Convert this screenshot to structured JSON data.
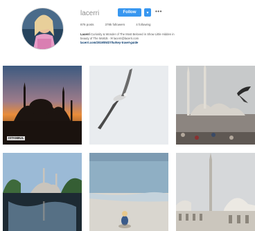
{
  "profile": {
    "username": "lacerri",
    "follow_label": "Follow",
    "dropdown_glyph": "▾",
    "more_glyph": "•••"
  },
  "stats": {
    "posts": "876 posts",
    "followers": "378k followers",
    "following": "4 following"
  },
  "bio": {
    "name": "Lacerri",
    "line1": "Curiosity & Wonder of The Most Beloved in Show Little Hidden in",
    "line2": "beauty of The Worlds · ✉ lacerri@lacerri.com",
    "link": "lacerri.com/2019/05/27/turkey-travel-guide"
  },
  "posts": [
    {
      "name": "post-mosque-sunset",
      "caption": "ISTANBUL"
    },
    {
      "name": "post-seagull"
    },
    {
      "name": "post-mosque-seagull"
    },
    {
      "name": "post-mosque-reflection"
    },
    {
      "name": "post-beach-girl"
    },
    {
      "name": "post-white-mosque"
    }
  ],
  "colors": {
    "accent": "#3897f0",
    "text": "#262626",
    "muted": "#8e8e8e"
  }
}
